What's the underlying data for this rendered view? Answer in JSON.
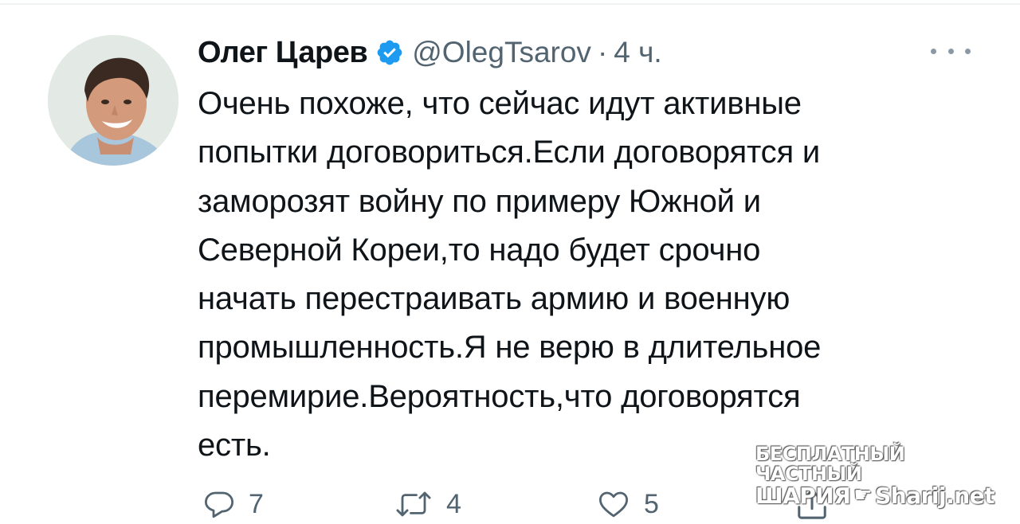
{
  "tweet": {
    "display_name": "Олег Царев",
    "handle": "@OlegTsarov",
    "separator": "·",
    "time": "4 ч.",
    "text": "Очень похоже, что сейчас идут активные\nпопытки договориться.Если договорятся и\nзаморозят войну по примеру Южной и\nСеверной Кореи,то надо будет срочно\nначать перестраивать армию и военную\nпромышленность.Я не верю в длительное\nперемирие.Вероятность,что договорятся\nесть.",
    "verified": true
  },
  "actions": {
    "reply_count": "7",
    "retweet_count": "4",
    "like_count": "5"
  },
  "watermark": {
    "line1": "БЕСПЛАТНЫЙ ЧАСТНЫЙ",
    "line2_left": "ШАРИЯ",
    "line2_right": "Sharij.net"
  },
  "colors": {
    "verified_blue": "#1d9bf0",
    "secondary_text": "#536471",
    "text": "#0f1419"
  },
  "icons": [
    "verified-badge-icon",
    "more-icon",
    "reply-icon",
    "retweet-icon",
    "like-icon",
    "share-icon",
    "pointing-hand-icon"
  ]
}
